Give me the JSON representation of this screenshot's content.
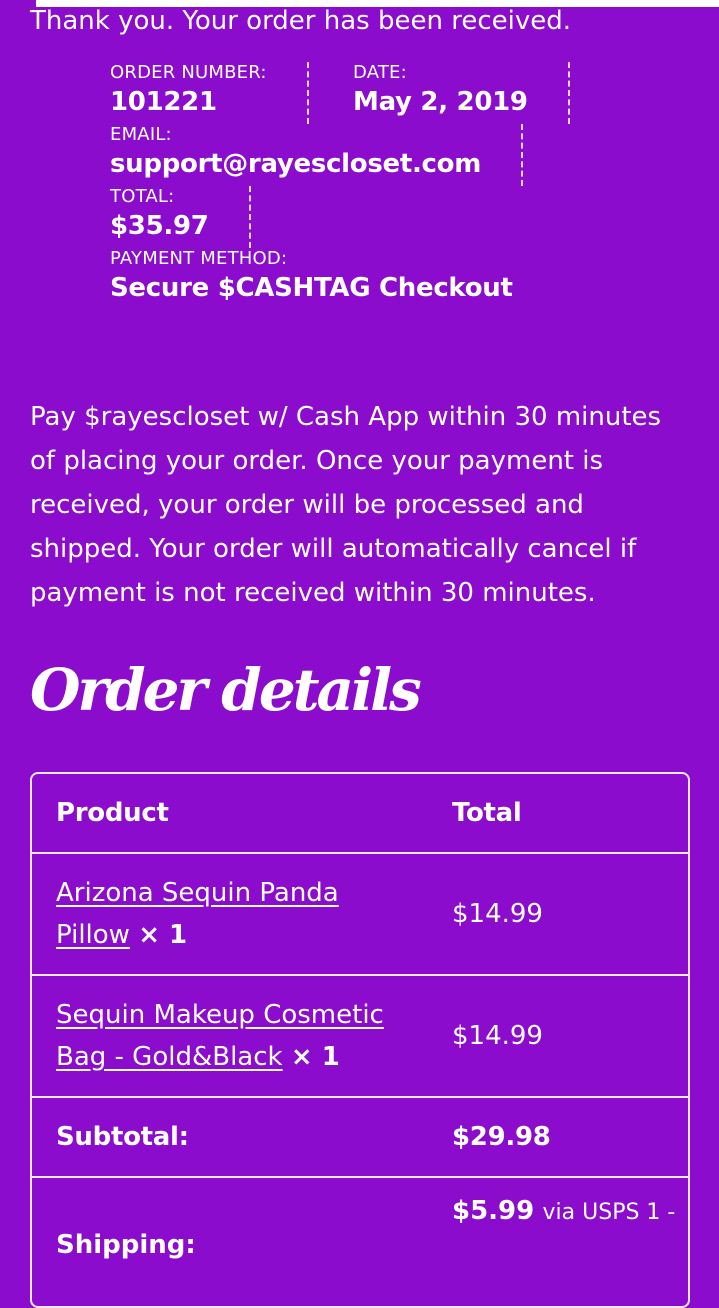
{
  "confirmation": "Thank you. Your order has been received.",
  "overview": {
    "order_number_label": "ORDER NUMBER:",
    "order_number": "101221",
    "date_label": "DATE:",
    "date": "May 2, 2019",
    "email_label": "EMAIL:",
    "email": "support@rayescloset.com",
    "total_label": "TOTAL:",
    "total": "$35.97",
    "payment_method_label": "PAYMENT METHOD:",
    "payment_method": "Secure $CASHTAG Checkout"
  },
  "payment_instructions": "Pay $rayescloset w/ Cash App within 30 minutes of placing your order. Once your payment is received, your order will be processed and shipped. Your order will automatically cancel if payment is not received within 30 minutes.",
  "order_details": {
    "heading": "Order details",
    "columns": [
      "Product",
      "Total"
    ],
    "items": [
      {
        "name_line1": "Arizona Sequin Panda",
        "name_line2": "Pillow",
        "qty": "× 1",
        "total": "$14.99"
      },
      {
        "name_line1": "Sequin Makeup Cosmetic",
        "name_line2": "Bag - Gold&Black",
        "qty": "× 1",
        "total": "$14.99"
      }
    ],
    "subtotal_label": "Subtotal:",
    "subtotal": "$29.98",
    "shipping_label": "Shipping:",
    "shipping": "$5.99",
    "shipping_method": "via USPS 1 -"
  },
  "colors": {
    "background": "#8b0ccc",
    "text": "#ffffff"
  }
}
